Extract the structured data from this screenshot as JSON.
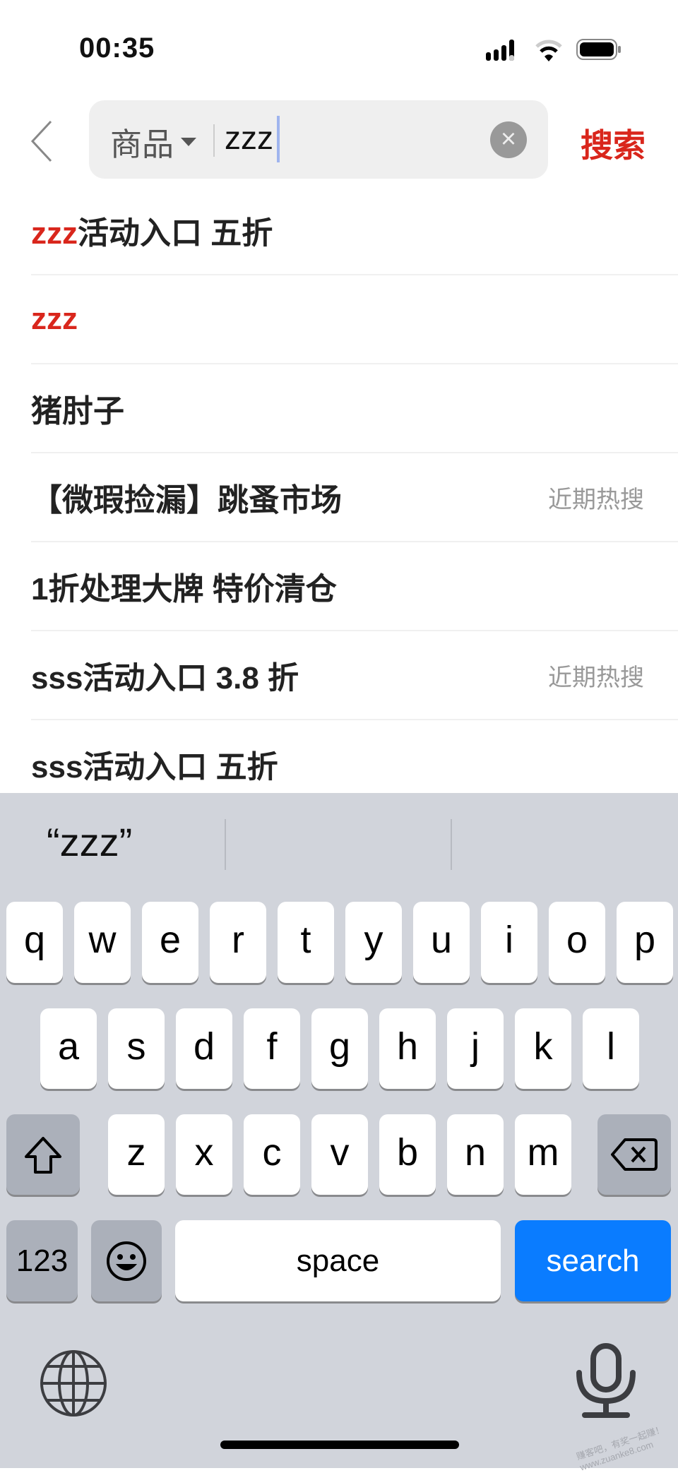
{
  "status_bar": {
    "time": "00:35"
  },
  "search": {
    "category": "商品",
    "query": "zzz",
    "submit_label": "搜索"
  },
  "suggestions": [
    {
      "highlight": "zzz",
      "rest": "活动入口 五折",
      "tag": ""
    },
    {
      "highlight": "zzz",
      "rest": "",
      "tag": ""
    },
    {
      "highlight": "",
      "rest": "猪肘子",
      "tag": ""
    },
    {
      "highlight": "",
      "rest": "【微瑕捡漏】跳蚤市场",
      "tag": "近期热搜"
    },
    {
      "highlight": "",
      "rest": "1折处理大牌 特价清仓",
      "tag": ""
    },
    {
      "highlight": "",
      "rest": "sss活动入口 3.8 折",
      "tag": "近期热搜"
    },
    {
      "highlight": "",
      "rest": "sss活动入口 五折",
      "tag": ""
    }
  ],
  "keyboard": {
    "prediction": "“zzz”",
    "row1": [
      "q",
      "w",
      "e",
      "r",
      "t",
      "y",
      "u",
      "i",
      "o",
      "p"
    ],
    "row2": [
      "a",
      "s",
      "d",
      "f",
      "g",
      "h",
      "j",
      "k",
      "l"
    ],
    "row3": [
      "z",
      "x",
      "c",
      "v",
      "b",
      "n",
      "m"
    ],
    "numbers_label": "123",
    "space_label": "space",
    "search_label": "search"
  },
  "watermark": "赚客吧，有奖一起赚！ www.zuanke8.com",
  "colors": {
    "accent": "#d9261c",
    "keyboard_bg": "#d1d4db",
    "search_key": "#0a7cff"
  }
}
